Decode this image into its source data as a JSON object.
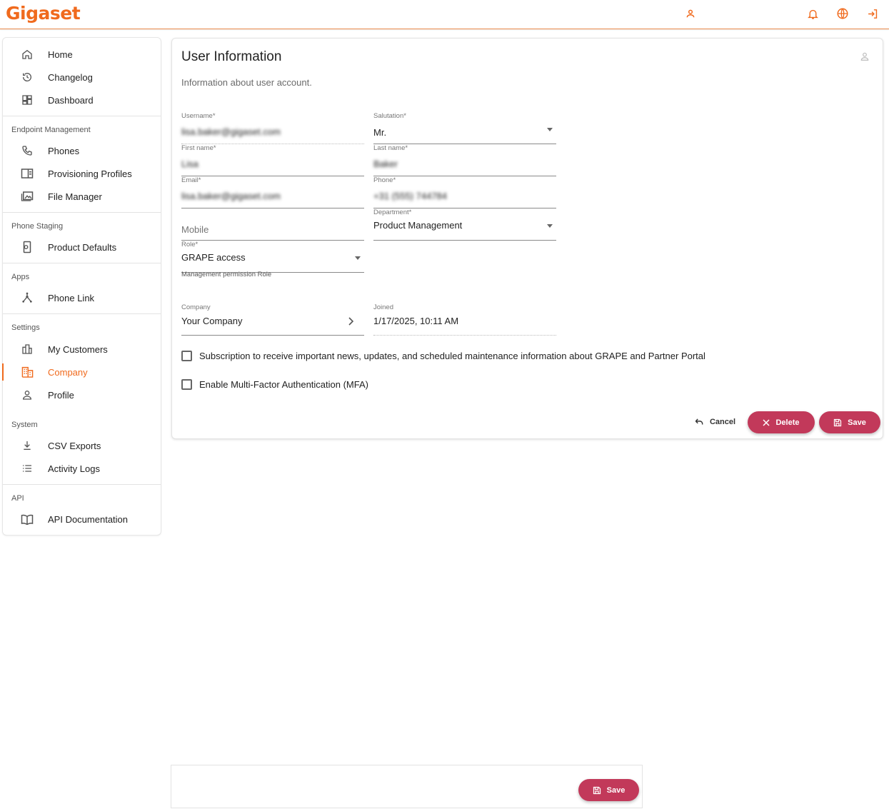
{
  "app": {
    "logo_text": "Gigaset",
    "accent_color": "#f06a1d",
    "danger_color": "#c2395a"
  },
  "topbar": {
    "icons": [
      "user-icon",
      "bell-icon",
      "globe-icon",
      "logout-icon"
    ]
  },
  "sidebar": {
    "main_items": [
      {
        "label": "Home",
        "icon": "home-icon"
      },
      {
        "label": "Changelog",
        "icon": "history-icon"
      },
      {
        "label": "Dashboard",
        "icon": "dashboard-icon"
      }
    ],
    "sections": {
      "endpoint": {
        "header": "Endpoint Management",
        "items": [
          {
            "label": "Phones",
            "icon": "phone-icon"
          },
          {
            "label": "Provisioning Profiles",
            "icon": "profile-card-icon"
          },
          {
            "label": "File Manager",
            "icon": "image-folder-icon"
          }
        ]
      },
      "staging": {
        "header": "Phone Staging",
        "items": [
          {
            "label": "Product Defaults",
            "icon": "device-settings-icon"
          }
        ]
      },
      "apps": {
        "header": "Apps",
        "items": [
          {
            "label": "Phone Link",
            "icon": "hub-icon"
          }
        ]
      },
      "settings": {
        "header": "Settings",
        "items": [
          {
            "label": "My Customers",
            "icon": "buildings-icon"
          },
          {
            "label": "Company",
            "icon": "company-icon"
          },
          {
            "label": "Profile",
            "icon": "person-icon"
          }
        ]
      },
      "system": {
        "header": "System",
        "items": [
          {
            "label": "CSV Exports",
            "icon": "download-icon"
          },
          {
            "label": "Activity Logs",
            "icon": "list-icon"
          }
        ]
      },
      "api": {
        "header": "API",
        "items": [
          {
            "label": "API Documentation",
            "icon": "book-icon"
          }
        ]
      }
    },
    "active_item": "Company"
  },
  "card": {
    "title": "User Information",
    "subtitle": "Information about user account.",
    "fields": {
      "username": {
        "label": "Username*",
        "value": "lisa.baker@gigaset.com"
      },
      "salutation": {
        "label": "Salutation*",
        "value": "Mr."
      },
      "first_name": {
        "label": "First name*",
        "value": "Lisa"
      },
      "last_name": {
        "label": "Last name*",
        "value": "Baker"
      },
      "email": {
        "label": "Email*",
        "value": "lisa.baker@gigaset.com"
      },
      "phone": {
        "label": "Phone*",
        "value": "+31 (555) 744784"
      },
      "mobile": {
        "placeholder": "Mobile"
      },
      "department": {
        "label": "Department*",
        "value": "Product Management"
      },
      "role": {
        "label": "Role*",
        "value": "GRAPE access",
        "hint": "Management permission Role"
      },
      "company": {
        "label": "Company",
        "value": "Your Company"
      },
      "joined": {
        "label": "Joined",
        "value": "1/17/2025, 10:11 AM"
      }
    },
    "checkboxes": {
      "subscription": "Subscription to receive important news, updates, and scheduled maintenance information about GRAPE and Partner Portal",
      "mfa": "Enable Multi-Factor Authentication (MFA)"
    },
    "actions": {
      "cancel": "Cancel",
      "delete": "Delete",
      "save": "Save"
    }
  },
  "bottom_bar": {
    "save": "Save"
  }
}
